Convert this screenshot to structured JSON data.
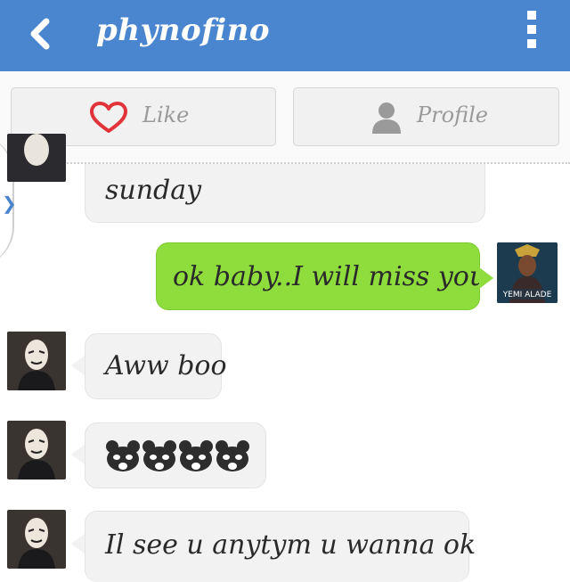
{
  "header": {
    "title": "phynofino",
    "back_icon": "chevron-left-icon",
    "menu_icon": "overflow-menu-icon",
    "color": "#4a86cf"
  },
  "actions": {
    "like_label": "Like",
    "profile_label": "Profile"
  },
  "messages": [
    {
      "side": "in",
      "text": "sunday"
    },
    {
      "side": "out",
      "text": "ok baby..I will miss you"
    },
    {
      "side": "in",
      "text": "Aww boo"
    },
    {
      "side": "in",
      "text": "🐼🐼🐼🐼",
      "kind": "emoji",
      "count": 4
    },
    {
      "side": "in",
      "text": "Il see u anytym u wanna ok"
    }
  ],
  "colors": {
    "outgoing_bubble": "#8fdd3c",
    "incoming_bubble": "#f2f2f2",
    "like_heart": "#e0333a"
  },
  "sent_avatar_text": "YEMI ALADE"
}
